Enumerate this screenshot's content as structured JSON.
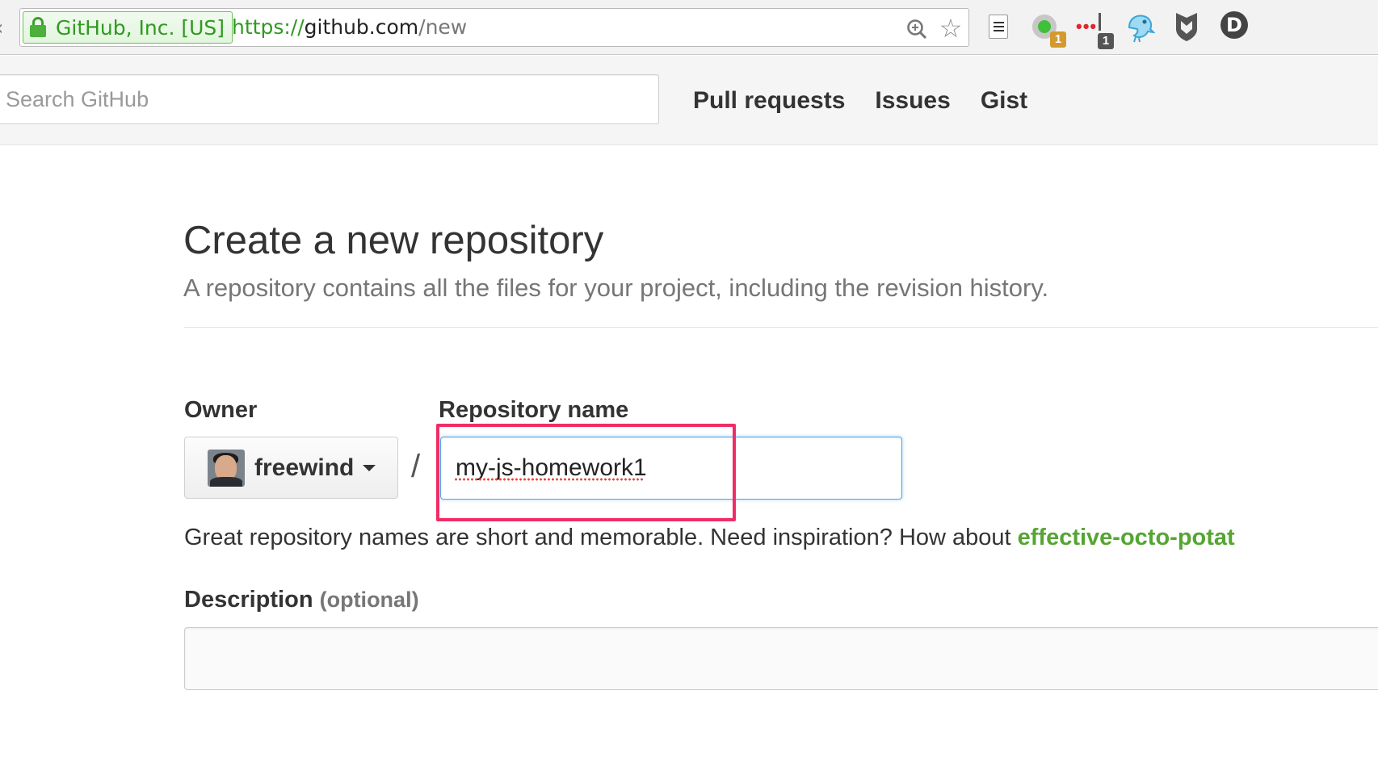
{
  "browser": {
    "ev_cert": "GitHub, Inc. [US]",
    "url_scheme": "https://",
    "url_host": "github.com",
    "url_path": "/new",
    "extension_badge_1": "1",
    "extension_badge_2": "1",
    "extension_d_label": "D",
    "icons": [
      "lock-icon",
      "zoom-icon",
      "star-icon",
      "page-icon",
      "circle-ext-icon",
      "more-ext-icon",
      "bird-icon",
      "shield-icon",
      "d-icon"
    ]
  },
  "header": {
    "search_placeholder": "Search GitHub",
    "nav": [
      "Pull requests",
      "Issues",
      "Gist"
    ]
  },
  "main": {
    "title": "Create a new repository",
    "subtitle": "A repository contains all the files for your project, including the revision history.",
    "owner_label": "Owner",
    "owner_name": "freewind",
    "separator": "/",
    "repo_label": "Repository name",
    "repo_value": "my-js-homework1",
    "hint_text": "Great repository names are short and memorable. Need inspiration? How about ",
    "hint_suggestion": "effective-octo-potat",
    "description_label": "Description",
    "description_optional": "(optional)",
    "description_value": ""
  },
  "colors": {
    "ev_green": "#2f9a1f",
    "focus_blue": "#51a7e8",
    "highlight": "#ef2d66",
    "suggestion_green": "#55a532"
  }
}
